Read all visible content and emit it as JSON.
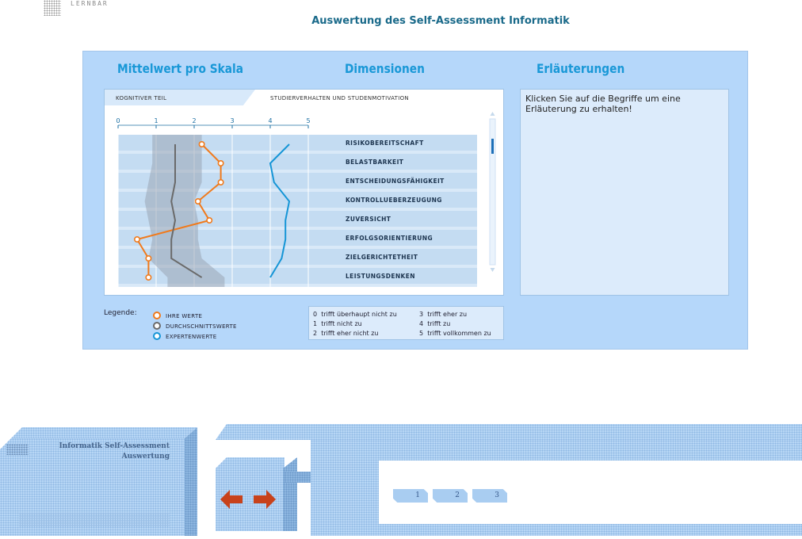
{
  "header": {
    "logo_text": "LERNBAR",
    "title": "Auswertung des Self-Assessment Informatik"
  },
  "sections": {
    "mean": "Mittelwert pro Skala",
    "dimensions": "Dimensionen",
    "explanations": "Erläuterungen"
  },
  "tabs": [
    {
      "label": "Kognitiver Teil",
      "active": false
    },
    {
      "label": "Studierverhalten und Studenmotivation",
      "active": true
    }
  ],
  "axis_ticks": [
    "0",
    "1",
    "2",
    "3",
    "4",
    "5"
  ],
  "explanation_text": "Klicken Sie auf die Begriffe um eine Erläuterung zu erhalten!",
  "legend": {
    "label": "Legende:",
    "items": [
      {
        "label": "Ihre Werte",
        "color": "#f07a1c"
      },
      {
        "label": "Durchschnittswerte",
        "color": "#6a6a6a"
      },
      {
        "label": "Expertenwerte",
        "color": "#1595d6"
      }
    ]
  },
  "scale": [
    {
      "num": "0",
      "text": "trifft überhaupt nicht zu"
    },
    {
      "num": "1",
      "text": "trifft nicht zu"
    },
    {
      "num": "2",
      "text": "trifft eher nicht zu"
    },
    {
      "num": "3",
      "text": "trifft eher zu"
    },
    {
      "num": "4",
      "text": "trifft zu"
    },
    {
      "num": "5",
      "text": "trifft vollkommen zu"
    }
  ],
  "chart_data": {
    "type": "line",
    "orientation": "horizontal-profile",
    "xlim": [
      0,
      5
    ],
    "x_ticks": [
      0,
      1,
      2,
      3,
      4,
      5
    ],
    "categories": [
      "RISIKOBEREITSCHAFT",
      "BELASTBARKEIT",
      "ENTSCHEIDUNGSFÄHIGKEIT",
      "KONTROLLUEBERZEUGUNG",
      "ZUVERSICHT",
      "ERFOLGSORIENTIERUNG",
      "ZIELGERICHTETHEIT",
      "LEISTUNGSDENKEN"
    ],
    "series": [
      {
        "name": "Ihre Werte",
        "color": "#f07a1c",
        "values": [
          2.2,
          2.7,
          2.7,
          2.1,
          2.4,
          0.5,
          0.8,
          0.8
        ]
      },
      {
        "name": "Durchschnittswerte",
        "color": "#6a6a6a",
        "values": [
          1.5,
          1.5,
          1.5,
          1.4,
          1.5,
          1.4,
          1.4,
          2.2
        ]
      },
      {
        "name": "Expertenwerte",
        "color": "#1595d6",
        "values": [
          4.5,
          4.0,
          4.1,
          4.5,
          4.4,
          4.4,
          4.3,
          4.0
        ]
      }
    ],
    "range_band": {
      "low": [
        0.9,
        0.9,
        0.8,
        0.7,
        0.8,
        0.9,
        0.8,
        1.3
      ],
      "high": [
        2.2,
        2.2,
        2.2,
        2.0,
        2.1,
        2.1,
        2.2,
        2.8
      ]
    }
  },
  "footer": {
    "title_line1": "Informatik Self-Assessment",
    "title_line2": "Auswertung",
    "pages": [
      "1",
      "2",
      "3"
    ]
  }
}
